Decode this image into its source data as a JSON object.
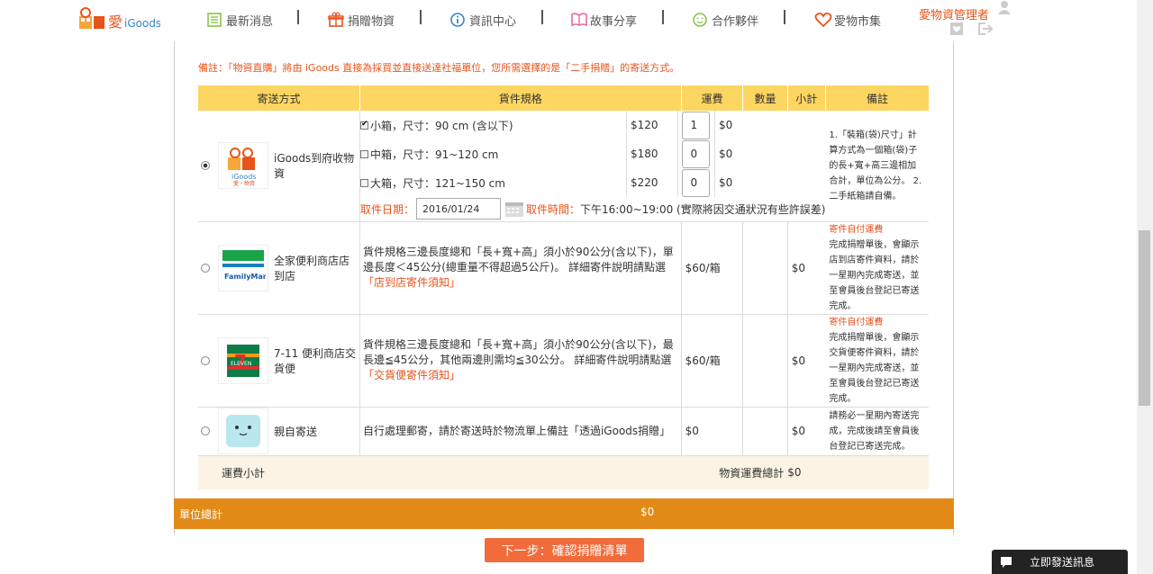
{
  "header": {
    "nav": [
      {
        "label": "最新消息",
        "icon": "news-icon"
      },
      {
        "label": "捐贈物資",
        "icon": "gift-icon"
      },
      {
        "label": "資訊中心",
        "icon": "info-icon"
      },
      {
        "label": "故事分享",
        "icon": "book-icon"
      },
      {
        "label": "合作夥伴",
        "icon": "smile-icon"
      },
      {
        "label": "愛物市集",
        "icon": "heart-icon"
      }
    ],
    "admin_name": "愛物資管理者"
  },
  "note": "備註：「物資直購」將由 iGoods 直接為採買並直接送達社福單位，您所需選擇的是「二手捐贈」的寄送方式。",
  "table": {
    "headers": [
      "寄送方式",
      "貨件規格",
      "運費",
      "數量",
      "小計",
      "備註"
    ],
    "rows": [
      {
        "method": "iGoods到府收物資",
        "specs": [
          {
            "label": "小箱，尺寸：90 cm (含以下)",
            "price": "$120",
            "qty": "1",
            "subtotal": "$0",
            "checked": true
          },
          {
            "label": "中箱，尺寸：91~120 cm",
            "price": "$180",
            "qty": "0",
            "subtotal": "$0",
            "checked": false
          },
          {
            "label": "大箱，尺寸：121~150 cm",
            "price": "$220",
            "qty": "0",
            "subtotal": "$0",
            "checked": false
          }
        ],
        "pickup_date_label": "取件日期：",
        "pickup_date": "2016/01/24",
        "pickup_time_label": "取件時間：",
        "pickup_time": "下午16:00~19:00 (實際將因交通狀況有些許誤差)",
        "remark": "1.「裝箱(袋)尺寸」計算方式為一個箱(袋)子的長+寬+高三邊相加合計，單位為公分。 2. 二手紙箱請自備。"
      },
      {
        "method": "全家便利商店店到店",
        "desc": "貨件規格三邊長度總和「長+寬+高」須小於90公分(含以下)，單邊長度＜45公分(總重量不得超過5公斤)。 詳細寄件說明請點選",
        "link": "「店到店寄件須知」",
        "price": "$60/箱",
        "subtotal": "$0",
        "remark_title": "寄件自付運費",
        "remark": "完成捐贈單後，會顯示店到店寄件資料，請於一星期內完成寄送，並至會員後台登記已寄送完成。"
      },
      {
        "method": "7-11 便利商店交貨便",
        "desc": "貨件規格三邊長度總和「長+寬+高」須小於90公分(含以下)，最長邊≦45公分，其他兩邊則需均≦30公分。 詳細寄件說明請點選",
        "link": "「交貨便寄件須知」",
        "price": "$60/箱",
        "subtotal": "$0",
        "remark_title": "寄件自付運費",
        "remark": "完成捐贈單後，會顯示交貨便寄件資料，請於一星期內完成寄送，並至會員後台登記已寄送完成。"
      },
      {
        "method": "親自寄送",
        "desc": "自行處理郵寄，請於寄送時於物流單上備註「透過iGoods捐贈」",
        "price": "$0",
        "subtotal": "$0",
        "remark": "請務必一星期內寄送完成，完成後請至會員後台登記已寄送完成。"
      }
    ],
    "subtotal_label": "運費小計",
    "freight_total_label": "物資運費總計",
    "freight_total": "$0"
  },
  "unit_total": {
    "label": "單位總計",
    "value": "$0"
  },
  "next_button": "下一步：確認捐贈清單",
  "chat_button": "立即發送訊息",
  "colors": {
    "accent": "#e8531b",
    "header_yellow": "#fdd561",
    "total_bar": "#e28a17",
    "button": "#f26b3a"
  }
}
